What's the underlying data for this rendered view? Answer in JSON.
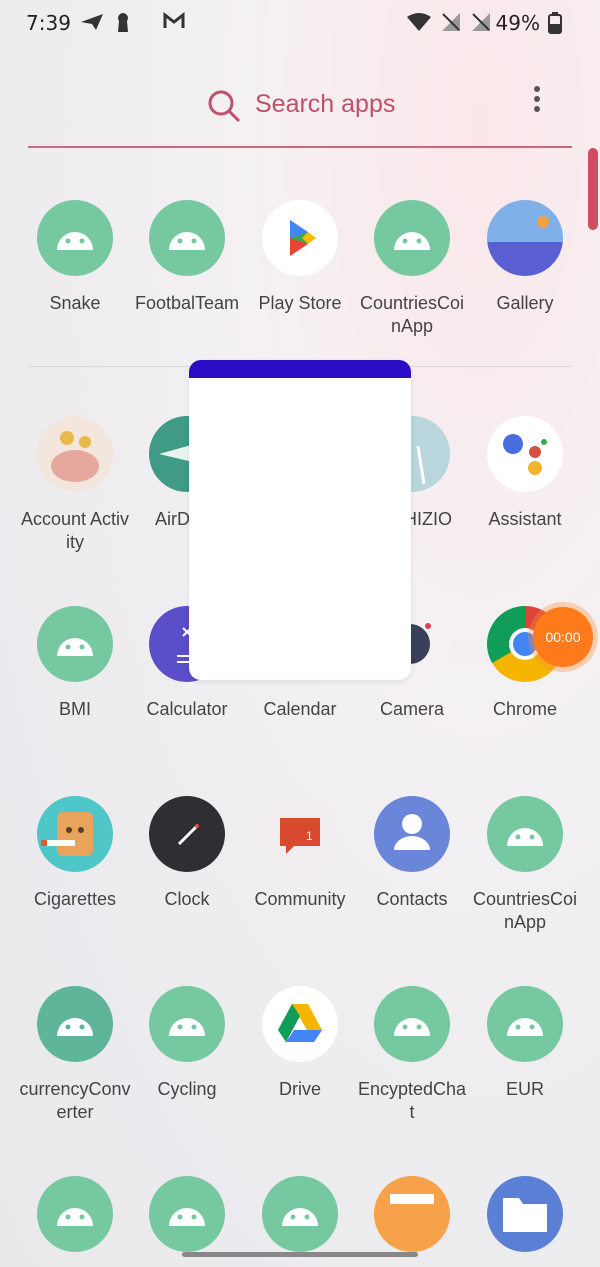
{
  "status": {
    "time": "7:39",
    "battery": "49%"
  },
  "search": {
    "placeholder": "Search apps"
  },
  "apps": [
    {
      "label": "Snake"
    },
    {
      "label": "FootbalTeam"
    },
    {
      "label": "Play Store"
    },
    {
      "label": "CountriesCoinApp"
    },
    {
      "label": "Gallery"
    },
    {
      "label": "Account Activity"
    },
    {
      "label": "AirD"
    },
    {
      "label": "HIZIO"
    },
    {
      "label": "Assistant"
    },
    {
      "label": "BMI"
    },
    {
      "label": "Calculator"
    },
    {
      "label": "Calendar"
    },
    {
      "label": "Camera"
    },
    {
      "label": "Chrome"
    },
    {
      "label": "Cigarettes"
    },
    {
      "label": "Clock"
    },
    {
      "label": "Community"
    },
    {
      "label": "Contacts"
    },
    {
      "label": "CountriesCoinApp"
    },
    {
      "label": "currencyConverter"
    },
    {
      "label": "Cycling"
    },
    {
      "label": "Drive"
    },
    {
      "label": "EncyptedChat"
    },
    {
      "label": "EUR"
    }
  ],
  "community_badge": "1",
  "timer": "00:00",
  "colors": {
    "accent": "#c0506c",
    "android_green": "#76c8a0",
    "popup_header": "#2a0cc4",
    "timer": "#ff7a1a"
  }
}
